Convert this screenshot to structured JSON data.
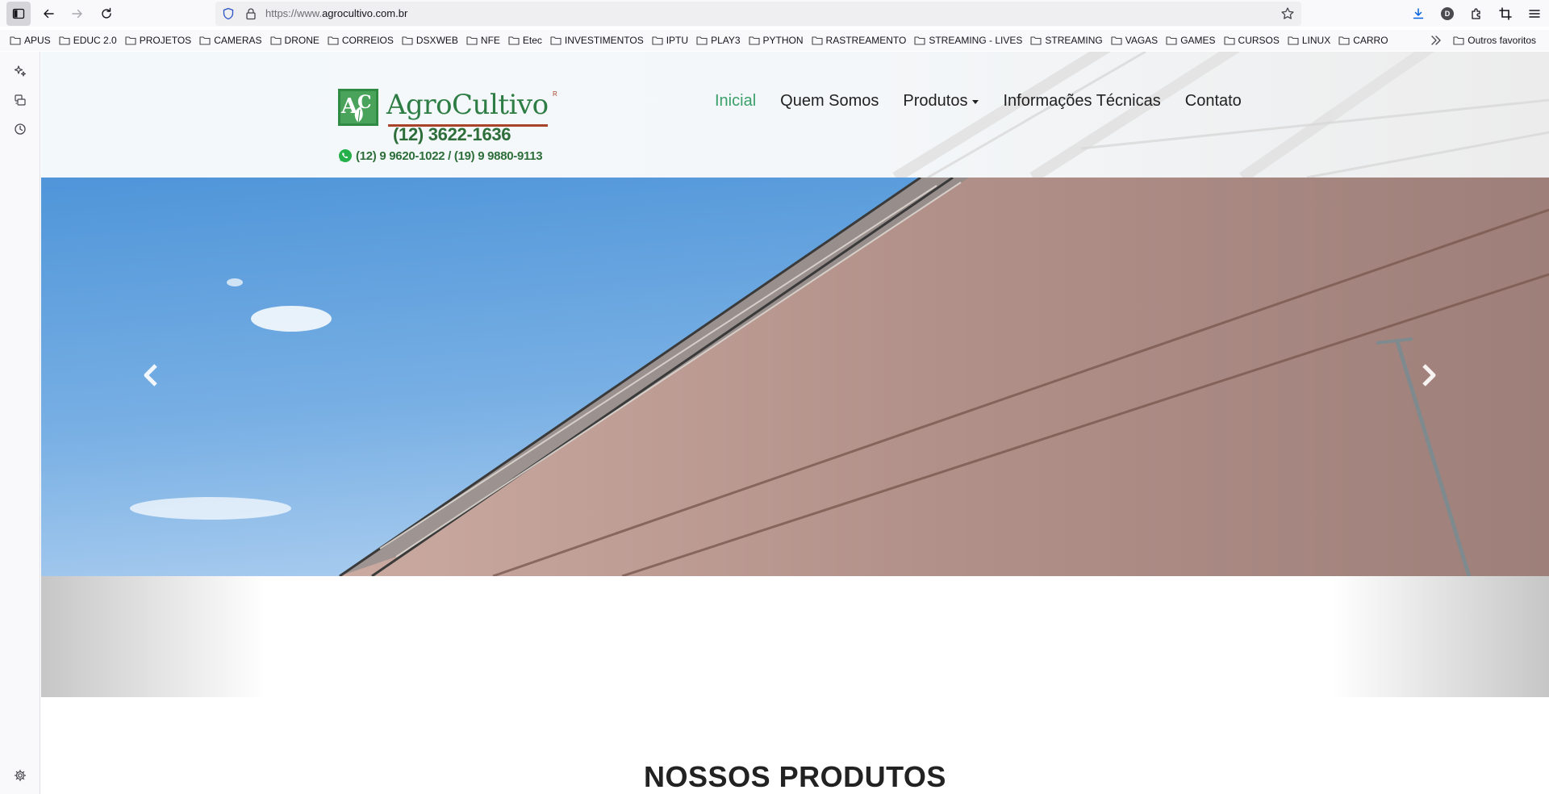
{
  "browser": {
    "url_prefix": "https://www.",
    "url_domain": "agrocultivo.com.br",
    "profile_initial": "D"
  },
  "bookmarks": {
    "items": [
      "APUS",
      "EDUC 2.0",
      "PROJETOS",
      "CAMERAS",
      "DRONE",
      "CORREIOS",
      "DSXWEB",
      "NFE",
      "Etec",
      "INVESTIMENTOS",
      "IPTU",
      "PLAY3",
      "PYTHON",
      "RASTREAMENTO",
      "STREAMING - LIVES",
      "STREAMING",
      "VAGAS",
      "GAMES",
      "CURSOS",
      "LINUX",
      "CARRO"
    ],
    "other": "Outros favoritos"
  },
  "site": {
    "logo_text": "AgroCultivo",
    "logo_registered": "R",
    "phone": "(12) 3622-1636",
    "whatsapp": "(12) 9 9620-1022 / (19) 9 9880-9113",
    "nav": {
      "inicial": "Inicial",
      "quem_somos": "Quem Somos",
      "produtos": "Produtos",
      "info_tecnicas": "Informações Técnicas",
      "contato": "Contato"
    },
    "section_title": "NOSSOS PRODUTOS"
  },
  "colors": {
    "brand_green": "#2e7d45",
    "nav_active": "#3aa06a",
    "logo_accent": "#a8432a"
  },
  "icons": [
    "sidebar-icon",
    "back-arrow-icon",
    "forward-arrow-icon",
    "reload-icon",
    "shield-icon",
    "lock-icon",
    "star-icon",
    "download-icon",
    "extensions-icon",
    "crop-icon",
    "menu-icon",
    "folder-icon",
    "chevron-double-right-icon",
    "ai-sparkle-icon",
    "synced-tabs-icon",
    "history-icon",
    "settings-icon",
    "whatsapp-icon",
    "chevron-left-icon",
    "chevron-right-icon"
  ]
}
